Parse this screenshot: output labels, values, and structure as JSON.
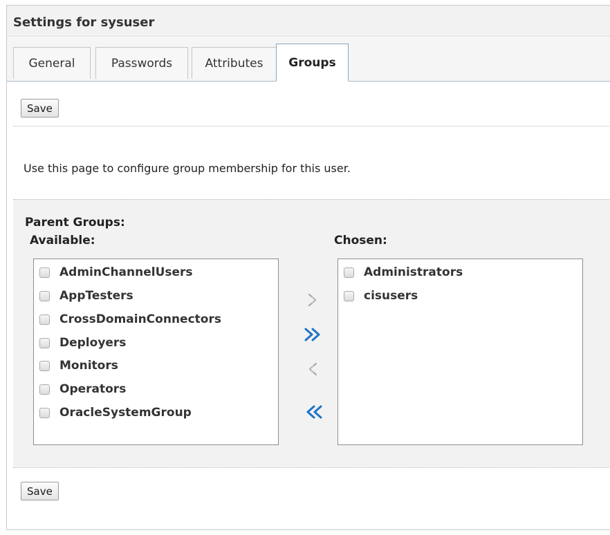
{
  "title": "Settings for sysuser",
  "tabs": [
    {
      "label": "General"
    },
    {
      "label": "Passwords"
    },
    {
      "label": "Attributes"
    },
    {
      "label": "Groups"
    }
  ],
  "actions": {
    "save_label": "Save"
  },
  "description": "Use this page to configure group membership for this user.",
  "parent_groups": {
    "heading": "Parent Groups:",
    "available_label": "Available:",
    "chosen_label": "Chosen:",
    "available": [
      "AdminChannelUsers",
      "AppTesters",
      "CrossDomainConnectors",
      "Deployers",
      "Monitors",
      "Operators",
      "OracleSystemGroup"
    ],
    "chosen": [
      "Administrators",
      "cisusers"
    ]
  },
  "icons": {
    "move": "chevron-right-icon",
    "move_all": "double-chevron-right-icon",
    "remove": "chevron-left-icon",
    "remove_all": "double-chevron-left-icon"
  },
  "colors": {
    "accent": "#1f73c4",
    "disabled_icon": "#a8a8a8",
    "panel_bg": "#f2f2f2",
    "tab_border_active": "#8ba5c2"
  }
}
